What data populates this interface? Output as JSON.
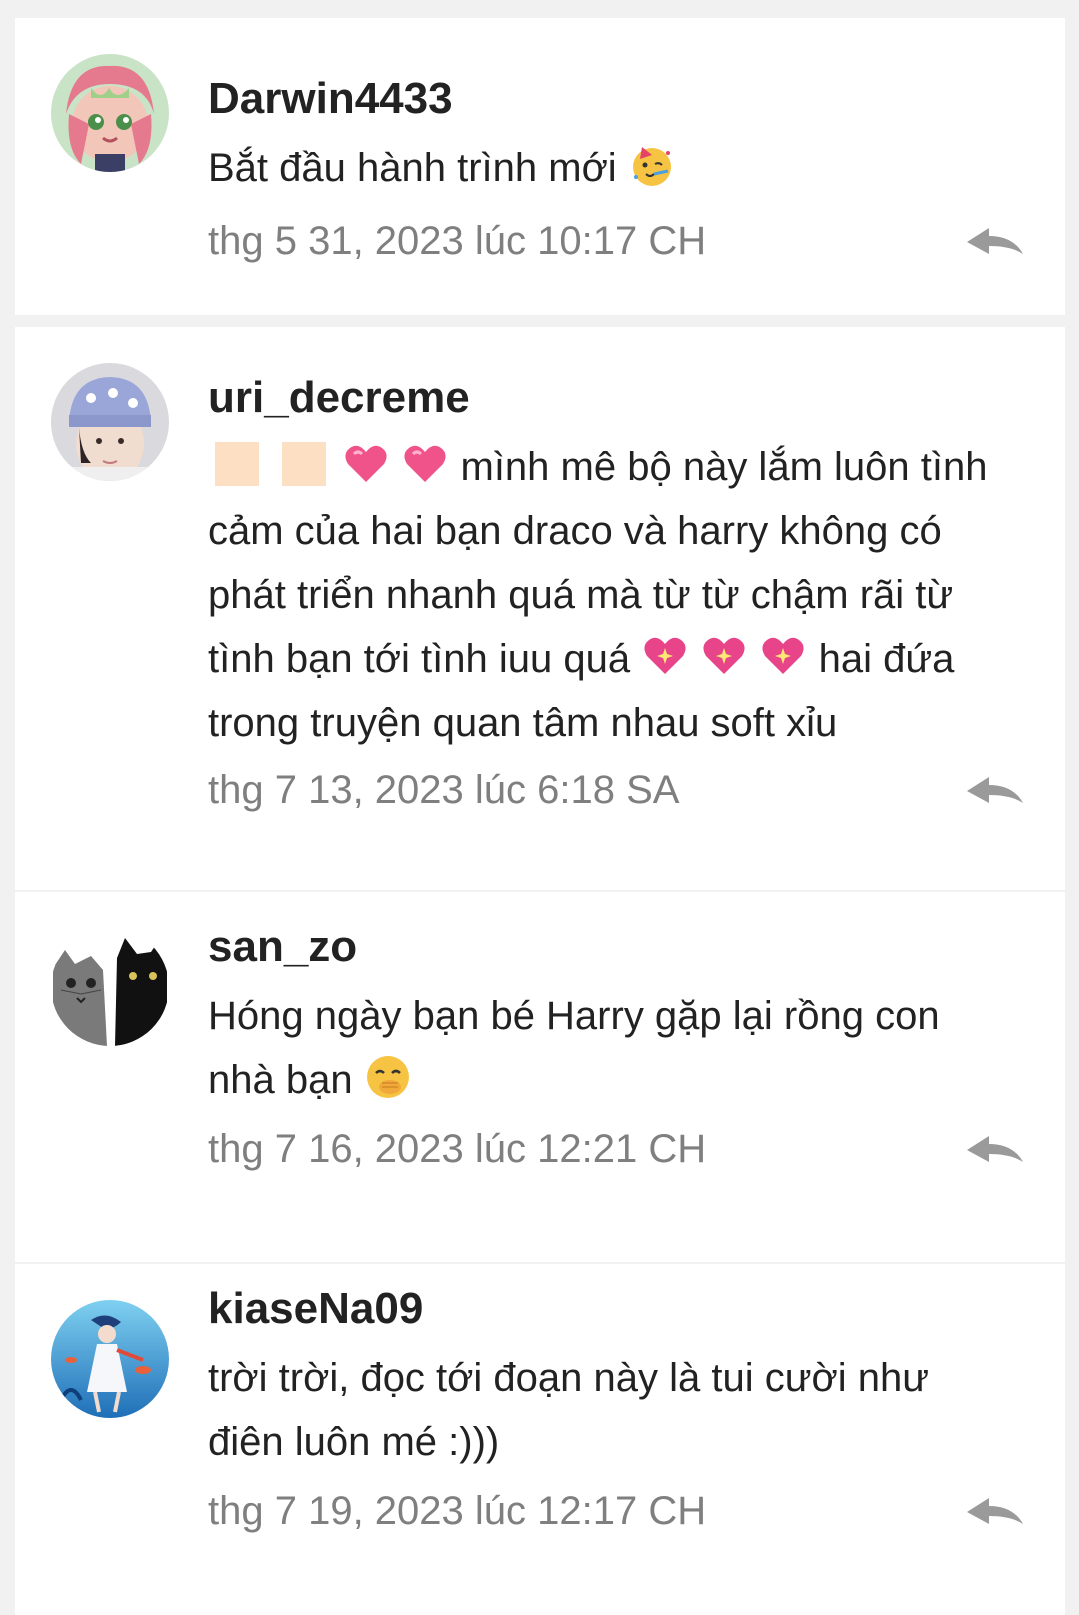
{
  "comments": [
    {
      "username": "Darwin4433",
      "lines": [
        "Bắt đầu hành trình mới"
      ],
      "emoji": "partying-face",
      "timestamp": "thg 5 31, 2023 lúc 10:17 CH"
    },
    {
      "username": "uri_decreme",
      "line1_text": "mình mê bộ này lắm luôn tình",
      "line2": "cảm của hai bạn draco và harry không có",
      "line3": "phát triển nhanh quá mà từ từ chậm rãi từ",
      "line4_before": "tình bạn tới tình iuu quá",
      "line4_after": "hai đứa",
      "line5": "trong truyện quan tâm nhau soft xỉu",
      "timestamp": "thg 7 13, 2023 lúc 6:18 SA"
    },
    {
      "username": "san_zo",
      "line1": "Hóng ngày bạn bé Harry gặp lại rồng con",
      "line2": "nhà bạn",
      "timestamp": "thg 7 16, 2023 lúc 12:21 CH"
    },
    {
      "username": "kiaseNa09",
      "line1": "trời trời, đọc tới đoạn này là tui cười như",
      "line2": "điên luôn mé :)))",
      "timestamp": "thg 7 19, 2023 lúc 12:17 CH"
    }
  ],
  "icons": {
    "reply": "reply-arrow-icon",
    "emoji_party": "partying-face-emoji",
    "emoji_heart": "pink-heart-emoji",
    "emoji_sparkle_heart": "sparkling-heart-emoji",
    "emoji_shy": "face-with-hand-over-mouth-emoji",
    "emoji_square": "peach-square-emoji"
  },
  "colors": {
    "background": "#f1f1f1",
    "card": "#ffffff",
    "text": "#222222",
    "muted": "#7f7f7f"
  }
}
